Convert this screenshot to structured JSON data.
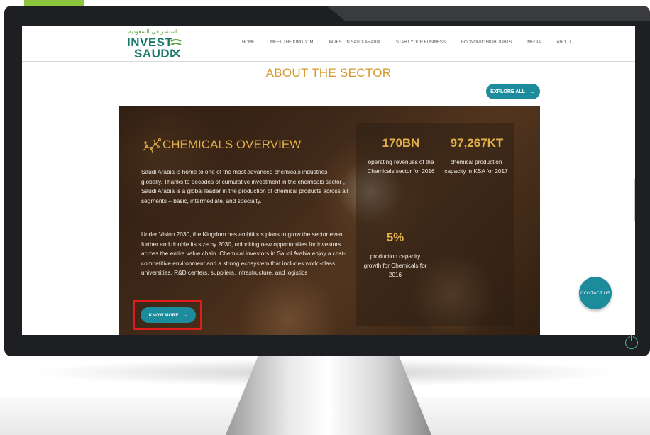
{
  "site": {
    "logo_arabic": "استثمر في السعودية",
    "logo_line1": "INVEST",
    "logo_line2": "SAUDI"
  },
  "nav": {
    "items": [
      "HOME",
      "MEET THE KINGDOM",
      "INVEST IN SAUDI ARABIA",
      "START YOUR BUSINESS",
      "ECONOMIC HIGHLIGHTS",
      "MEDIA",
      "ABOUT"
    ]
  },
  "section": {
    "title": "ABOUT THE SECTOR",
    "explore_label": "EXPLORE ALL",
    "explore_arrow": "→"
  },
  "overview": {
    "title": "CHEMICALS OVERVIEW",
    "paragraph1": "Saudi Arabia is home to one of the most advanced chemicals industries globally. Thanks to decades of cumulative investment in the chemicals sector , Saudi Arabia is a global leader in the production of chemical products across all segments – basic, intermediate, and specialty.",
    "paragraph2": "Under Vision 2030, the Kingdom has ambitious plans to grow the sector even further and double its size by 2030, unlocking new opportunities for investors across the entire value chain. Chemical investors in Saudi Arabia enjoy a cost-competitive environment and a strong ecosystem that includes world-class universities, R&D centers, suppliers, infrastructure, and logistics",
    "know_more_label": "KNOW MORE",
    "know_more_arrow": "→"
  },
  "stats": [
    {
      "value": "170BN",
      "label": "operating revenues of the Chemicals sector for 2016"
    },
    {
      "value": "97,267KT",
      "label": "chemical production capacity in KSA for 2017"
    },
    {
      "value": "5%",
      "label": "production capacity growth for Chemicals for 2016"
    }
  ],
  "contact": {
    "label": "CONTACT US"
  },
  "colors": {
    "accent_teal": "#1c8b9c",
    "gold": "#e2b04a",
    "heading_orange": "#d49a2f",
    "highlight_red": "#e01c1c",
    "brand_green": "#8cc63f"
  },
  "icons": {
    "molecule": "chemical-molecule-icon",
    "arrow": "arrow-right-icon",
    "power": "power-icon"
  }
}
